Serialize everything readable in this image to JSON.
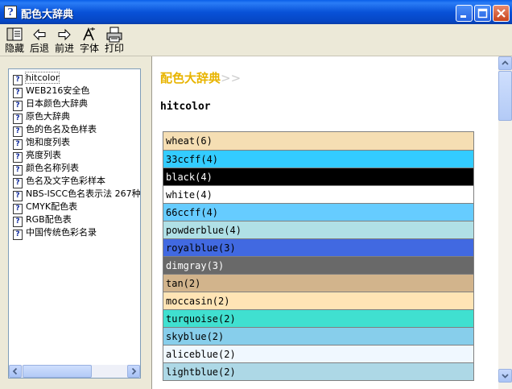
{
  "window": {
    "title": "配色大辞典",
    "icon_glyph": "?"
  },
  "toolbar": {
    "items": [
      {
        "id": "hide",
        "label": "隐藏",
        "icon": "hide-icon"
      },
      {
        "id": "back",
        "label": "后退",
        "icon": "back-arrow-icon"
      },
      {
        "id": "forward",
        "label": "前进",
        "icon": "forward-arrow-icon"
      },
      {
        "id": "font",
        "label": "字体",
        "icon": "font-icon"
      },
      {
        "id": "print",
        "label": "打印",
        "icon": "print-icon"
      }
    ]
  },
  "sidebar": {
    "items": [
      {
        "label": "hitcolor"
      },
      {
        "label": "WEB216安全色"
      },
      {
        "label": "日本颜色大辞典"
      },
      {
        "label": "原色大辞典"
      },
      {
        "label": "色的色名及色样表"
      },
      {
        "label": "饱和度列表"
      },
      {
        "label": "亮度列表"
      },
      {
        "label": "颜色名称列表"
      },
      {
        "label": "色名及文字色彩样本"
      },
      {
        "label": "NBS-ISCC色名表示法 267种"
      },
      {
        "label": "CMYK配色表"
      },
      {
        "label": "RGB配色表"
      },
      {
        "label": "中国传统色彩名录"
      }
    ],
    "selected_index": 0
  },
  "content": {
    "heading": "配色大辞典",
    "heading_arrows": ">>",
    "heading_color": "#e8b400",
    "subheading": "hitcolor",
    "colors": [
      {
        "label": "wheat(6)",
        "bg": "#f5deb3",
        "fg": "#000000"
      },
      {
        "label": "33ccff(4)",
        "bg": "#33ccff",
        "fg": "#000000"
      },
      {
        "label": "black(4)",
        "bg": "#000000",
        "fg": "#ffffff"
      },
      {
        "label": "white(4)",
        "bg": "#ffffff",
        "fg": "#000000"
      },
      {
        "label": "66ccff(4)",
        "bg": "#66ccff",
        "fg": "#000000"
      },
      {
        "label": "powderblue(4)",
        "bg": "#b0e0e6",
        "fg": "#000000"
      },
      {
        "label": "royalblue(3)",
        "bg": "#4169e1",
        "fg": "#000000"
      },
      {
        "label": "dimgray(3)",
        "bg": "#696969",
        "fg": "#ffffff"
      },
      {
        "label": "tan(2)",
        "bg": "#d2b48c",
        "fg": "#000000"
      },
      {
        "label": "moccasin(2)",
        "bg": "#ffe4b5",
        "fg": "#000000"
      },
      {
        "label": "turquoise(2)",
        "bg": "#40e0d0",
        "fg": "#000000"
      },
      {
        "label": "skyblue(2)",
        "bg": "#87ceeb",
        "fg": "#000000"
      },
      {
        "label": "aliceblue(2)",
        "bg": "#f0f8ff",
        "fg": "#000000"
      },
      {
        "label": "lightblue(2)",
        "bg": "#add8e6",
        "fg": "#000000"
      }
    ]
  }
}
